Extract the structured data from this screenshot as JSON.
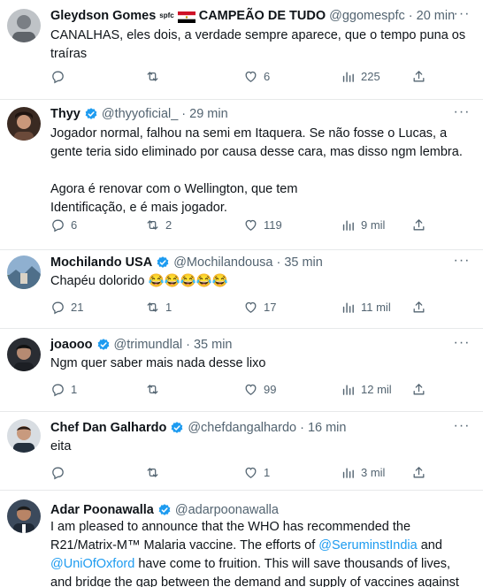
{
  "tweets": [
    {
      "name": "Gleydson Gomes",
      "name_suffix": "spfc",
      "name_tail": "CAMPEÃO DE TUDO",
      "handle": "@ggomespfc",
      "time": "20 min",
      "text": "CANALHAS, eles dois, a verdade sempre aparece, que o tempo puna os traíras",
      "replies": "",
      "retweets": "",
      "likes": "6",
      "views": "225"
    },
    {
      "name": "Thyy",
      "handle": "@thyyoficial_",
      "time": "29 min",
      "text": "Jogador normal, falhou na semi em Itaquera. Se não fosse o Lucas, a gente teria sido eliminado por causa desse cara, mas disso ngm lembra.",
      "text2": "Agora é renovar com o Wellington, que tem Identificação, e é mais jogador.",
      "replies": "6",
      "retweets": "2",
      "likes": "119",
      "views": "9 mil"
    },
    {
      "name": "Mochilando USA",
      "handle": "@Mochilandousa",
      "time": "35 min",
      "text": "Chapéu dolorido 😂😂😂😂😂",
      "replies": "21",
      "retweets": "1",
      "likes": "17",
      "views": "11 mil"
    },
    {
      "name": "joaooo",
      "handle": "@trimundlal",
      "time": "35 min",
      "text": "Ngm quer saber mais nada desse lixo",
      "replies": "1",
      "retweets": "",
      "likes": "99",
      "views": "12 mil"
    },
    {
      "name": "Chef Dan Galhardo",
      "handle": "@chefdangalhardo",
      "time": "16 min",
      "text": "eita",
      "replies": "",
      "retweets": "",
      "likes": "1",
      "views": "3 mil"
    },
    {
      "name": "Adar Poonawalla",
      "handle": "@adarpoonawalla",
      "time": "",
      "text_a": "I am pleased to announce that the WHO has recommended the R21/Matrix-M™ Malaria vaccine. The efforts of ",
      "mention1": "@SeruminstIndia",
      "text_b": " and ",
      "mention2": "@UniOfOxford",
      "text_c": " have come to fruition. This will save thousands of lives, and bridge the gap between the demand and supply of vaccines against"
    }
  ],
  "icons": {
    "reply": "reply-icon",
    "retweet": "retweet-icon",
    "like": "heart-icon",
    "views": "views-icon",
    "share": "share-icon",
    "more": "more-icon",
    "verified": "verified-badge-icon"
  },
  "colors": {
    "accent": "#1d9bf0",
    "muted": "#536471",
    "text": "#0f1419",
    "divider": "#e7e9ea"
  }
}
